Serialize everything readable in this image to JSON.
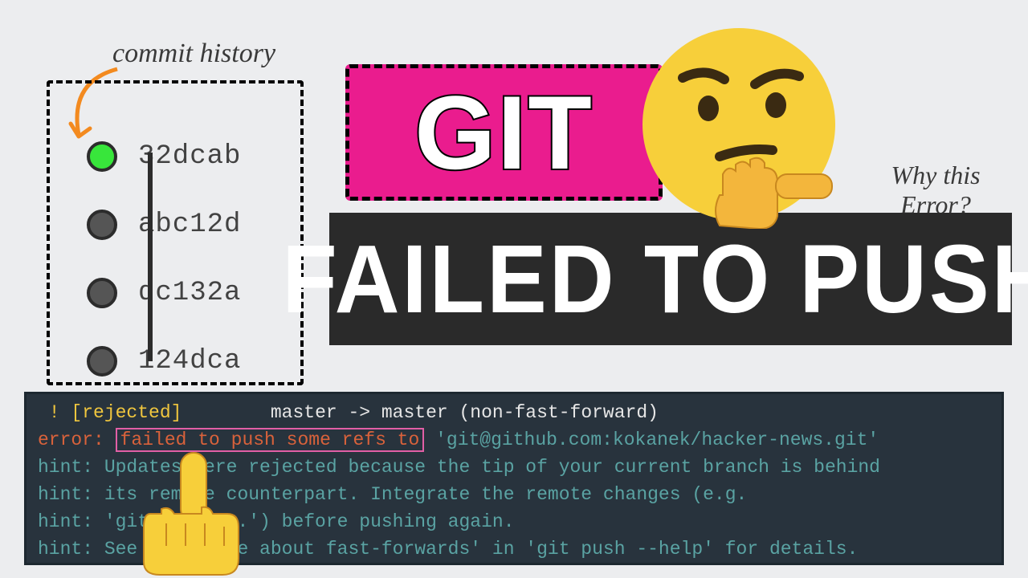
{
  "history": {
    "label": "commit history",
    "commits": [
      "32dcab",
      "abc12d",
      "dc132a",
      "124dca"
    ]
  },
  "badge": {
    "git": "GIT"
  },
  "caption": {
    "why": "Why this Error?"
  },
  "headline": {
    "text": "FAILED TO PUSH"
  },
  "terminal": {
    "line1_rejected": " ! [rejected]",
    "line1_master": "        master -> master (non-fast-forward)",
    "line2_error": "error: ",
    "line2_boxed": "failed to push some refs to",
    "line2_remote": " 'git@github.com:kokanek/hacker-news.git'",
    "hint1": "hint: Updates were rejected because the tip of your current branch is behind",
    "hint2": "hint: its remote counterpart. Integrate the remote changes (e.g.",
    "hint3": "hint: 'git pull ...') before pushing again.",
    "hint4": "hint: See the 'Note about fast-forwards' in 'git push --help' for details."
  }
}
